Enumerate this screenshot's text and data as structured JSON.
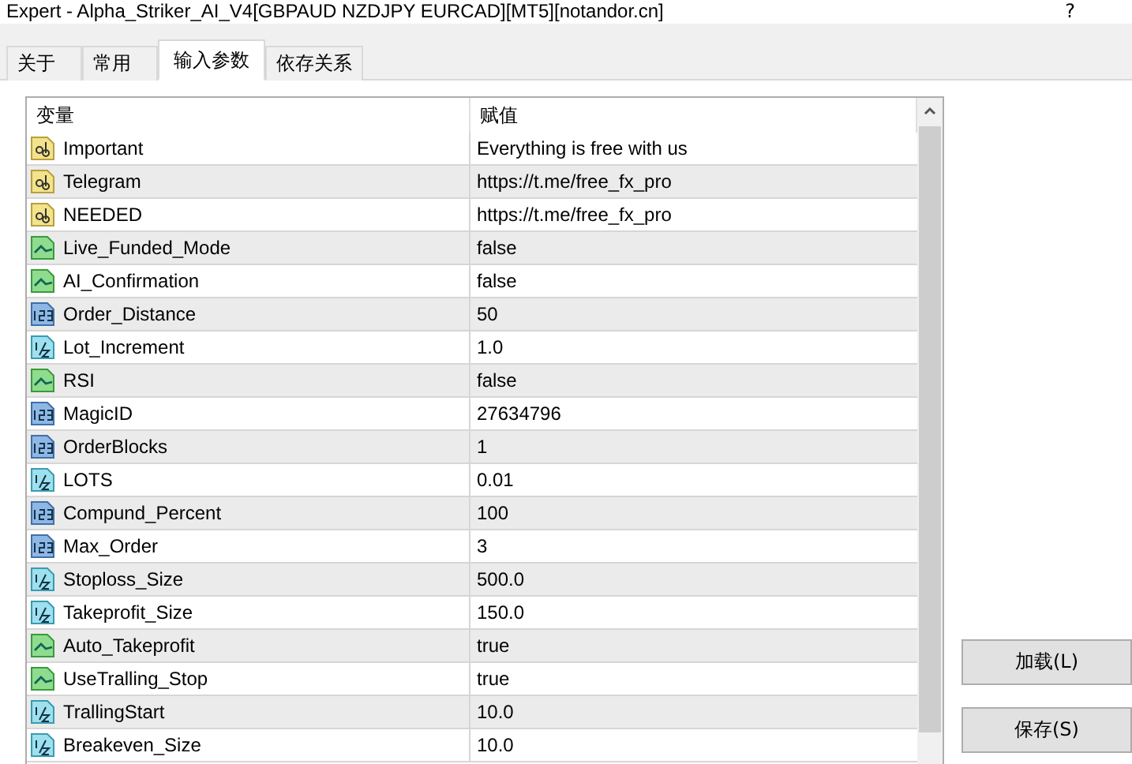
{
  "window": {
    "title": "Expert - Alpha_Striker_AI_V4[GBPAUD NZDJPY EURCAD][MT5][notandor.cn]",
    "help": "?"
  },
  "tabs": [
    {
      "label": "关于",
      "selected": false
    },
    {
      "label": "常用",
      "selected": false
    },
    {
      "label": "输入参数",
      "selected": true
    },
    {
      "label": "依存关系",
      "selected": false
    }
  ],
  "table": {
    "columns": [
      "变量",
      "赋值"
    ],
    "rows": [
      {
        "kind": "string",
        "name": "Important",
        "value": "Everything is free with us"
      },
      {
        "kind": "string",
        "name": "Telegram",
        "value": "https://t.me/free_fx_pro"
      },
      {
        "kind": "string",
        "name": "NEEDED",
        "value": "https://t.me/free_fx_pro"
      },
      {
        "kind": "bool",
        "name": "Live_Funded_Mode",
        "value": "false"
      },
      {
        "kind": "bool",
        "name": "AI_Confirmation",
        "value": "false"
      },
      {
        "kind": "int",
        "name": "Order_Distance",
        "value": "50"
      },
      {
        "kind": "double",
        "name": "Lot_Increment",
        "value": "1.0"
      },
      {
        "kind": "bool",
        "name": "RSI",
        "value": "false"
      },
      {
        "kind": "int",
        "name": "MagicID",
        "value": "27634796"
      },
      {
        "kind": "int",
        "name": "OrderBlocks",
        "value": "1"
      },
      {
        "kind": "double",
        "name": "LOTS",
        "value": "0.01"
      },
      {
        "kind": "int",
        "name": "Compund_Percent",
        "value": "100"
      },
      {
        "kind": "int",
        "name": "Max_Order",
        "value": "3"
      },
      {
        "kind": "double",
        "name": "Stoploss_Size",
        "value": "500.0"
      },
      {
        "kind": "double",
        "name": "Takeprofit_Size",
        "value": "150.0"
      },
      {
        "kind": "bool",
        "name": "Auto_Takeprofit",
        "value": "true"
      },
      {
        "kind": "bool",
        "name": "UseTralling_Stop",
        "value": "true"
      },
      {
        "kind": "double",
        "name": "TrallingStart",
        "value": "10.0"
      },
      {
        "kind": "double",
        "name": "Breakeven_Size",
        "value": "10.0"
      }
    ]
  },
  "buttons": [
    "加载(L)",
    "保存(S)"
  ]
}
